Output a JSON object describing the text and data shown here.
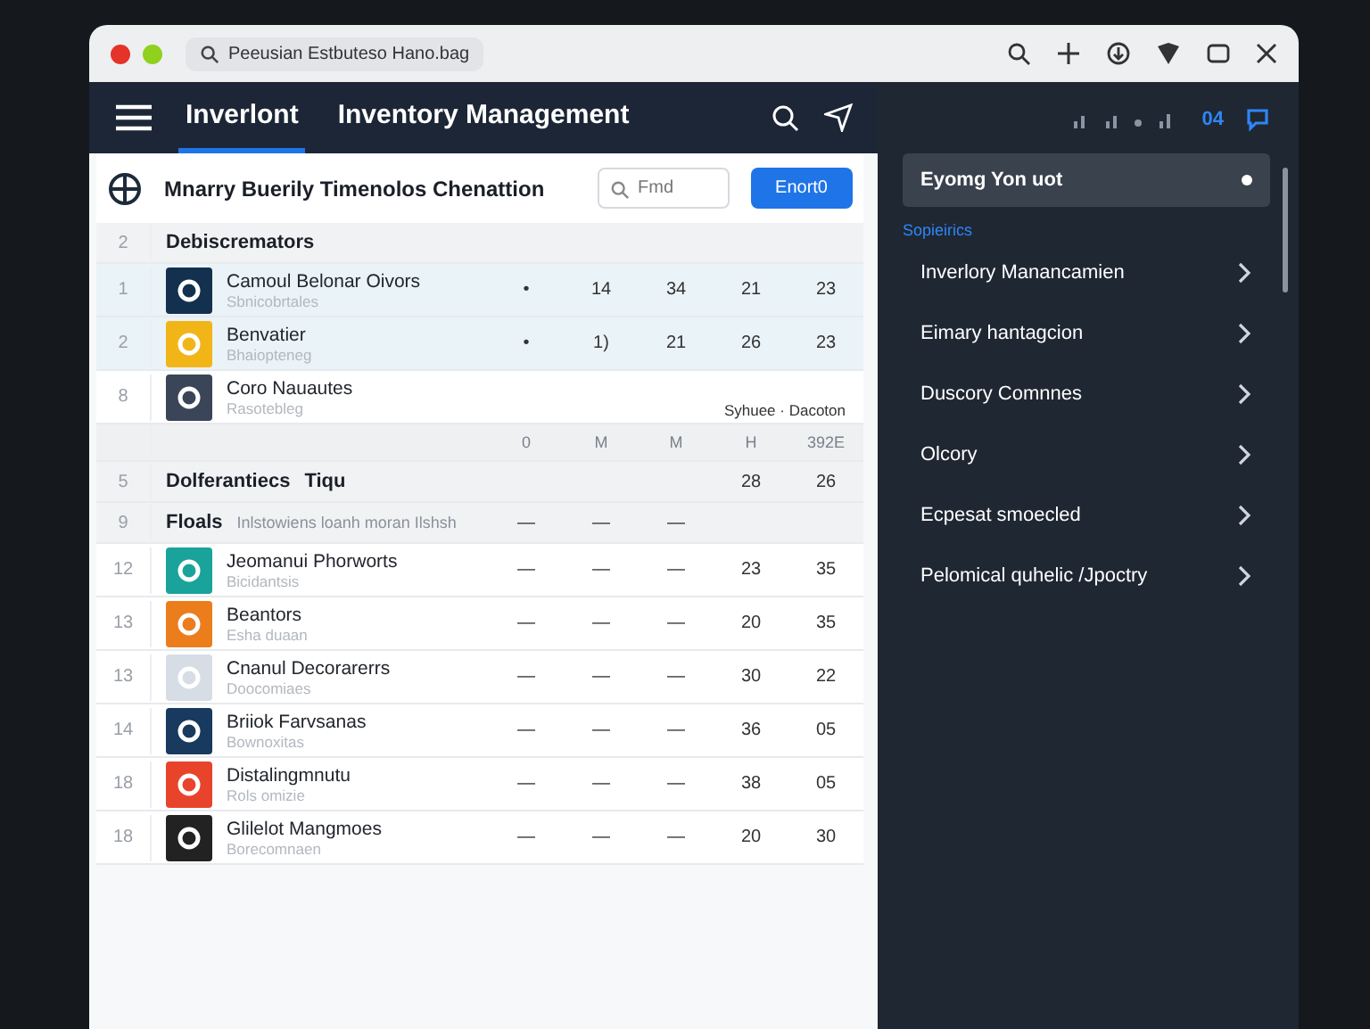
{
  "browser": {
    "address": "Peeusian Estbuteso Hano.bag"
  },
  "status": {
    "count": "04"
  },
  "header": {
    "tabs": [
      {
        "label": "Inverlont",
        "selected": true
      },
      {
        "label": "Inventory Management",
        "selected": false
      }
    ]
  },
  "panel": {
    "title": "Mnarry Buerily Timenolos Chenattion",
    "search": {
      "placeholder": "Fmd"
    },
    "button": "Enort0"
  },
  "rows": [
    {
      "kind": "group",
      "num": "2",
      "label": "Debiscremators"
    },
    {
      "kind": "item",
      "num": "1",
      "name": "Camoul Belonar Oivors",
      "sub": "Sbnicobrtales",
      "color": "#14304f",
      "selected": true,
      "cells": [
        "•",
        "14",
        "34",
        "21",
        "23"
      ]
    },
    {
      "kind": "item",
      "num": "2",
      "name": "Benvatier",
      "sub": "Bhaiopteneg",
      "color": "#f2b518",
      "selected": true,
      "cells": [
        "•",
        "1)",
        "21",
        "26",
        "23"
      ]
    },
    {
      "kind": "item",
      "num": "8",
      "name": "Coro Nauautes",
      "sub": "Rasotebleg",
      "color": "#3a4558",
      "selected": false,
      "note": "Syhuee · Dacoton"
    },
    {
      "kind": "columns",
      "cells": [
        "0",
        "M",
        "M",
        "H",
        "392E"
      ]
    },
    {
      "kind": "group",
      "num": "5",
      "label": "Dolferantiecs",
      "tag": "Tiqu",
      "cells": [
        null,
        null,
        null,
        "28",
        "26"
      ]
    },
    {
      "kind": "group",
      "num": "9",
      "label": "Floals",
      "description": "Inlstowiens loanh moran Ilshsh",
      "cells": [
        "—",
        "—",
        "—",
        null,
        null
      ]
    },
    {
      "kind": "item",
      "num": "12",
      "name": "Jeomanui Phorworts",
      "sub": "Bicidantsis",
      "color": "#1aa39a",
      "selected": false,
      "cells": [
        "—",
        "—",
        "—",
        "23",
        "35"
      ]
    },
    {
      "kind": "item",
      "num": "13",
      "name": "Beantors",
      "sub": "Esha duaan",
      "color": "#ec7d1c",
      "selected": false,
      "cells": [
        "—",
        "—",
        "—",
        "20",
        "35"
      ]
    },
    {
      "kind": "item",
      "num": "13",
      "name": "Cnanul Decorarerrs",
      "sub": "Doocomiaes",
      "color": "#d7dde5",
      "selected": false,
      "cells": [
        "—",
        "—",
        "—",
        "30",
        "22"
      ]
    },
    {
      "kind": "item",
      "num": "14",
      "name": "Briiok Farvsanas",
      "sub": "Bownoxitas",
      "color": "#173a5e",
      "selected": false,
      "cells": [
        "—",
        "—",
        "—",
        "36",
        "05"
      ]
    },
    {
      "kind": "item",
      "num": "18",
      "name": "Distalingmnutu",
      "sub": "Rols omizie",
      "color": "#e8442c",
      "selected": false,
      "cells": [
        "—",
        "—",
        "—",
        "38",
        "05"
      ]
    },
    {
      "kind": "item",
      "num": "18",
      "name": "Glilelot Mangmoes",
      "sub": "Borecomnaen",
      "color": "#222222",
      "selected": false,
      "cells": [
        "—",
        "—",
        "—",
        "20",
        "30"
      ]
    }
  ],
  "sidebar": {
    "items": [
      {
        "kind": "item",
        "label": "Eyomg Yon uot",
        "selected": true
      },
      {
        "kind": "section",
        "label": "Sopieirics"
      },
      {
        "kind": "item",
        "label": "Inverlory Manancamien",
        "selected": false
      },
      {
        "kind": "item",
        "label": "Eimary hantagcion",
        "selected": false
      },
      {
        "kind": "item",
        "label": "Duscory Comnnes",
        "selected": false
      },
      {
        "kind": "item",
        "label": "Olcory",
        "selected": false
      },
      {
        "kind": "item",
        "label": "Ecpesat smoecled",
        "selected": false
      },
      {
        "kind": "item",
        "label": "Pelomical quhelic /Jpoctry",
        "selected": false
      }
    ]
  }
}
